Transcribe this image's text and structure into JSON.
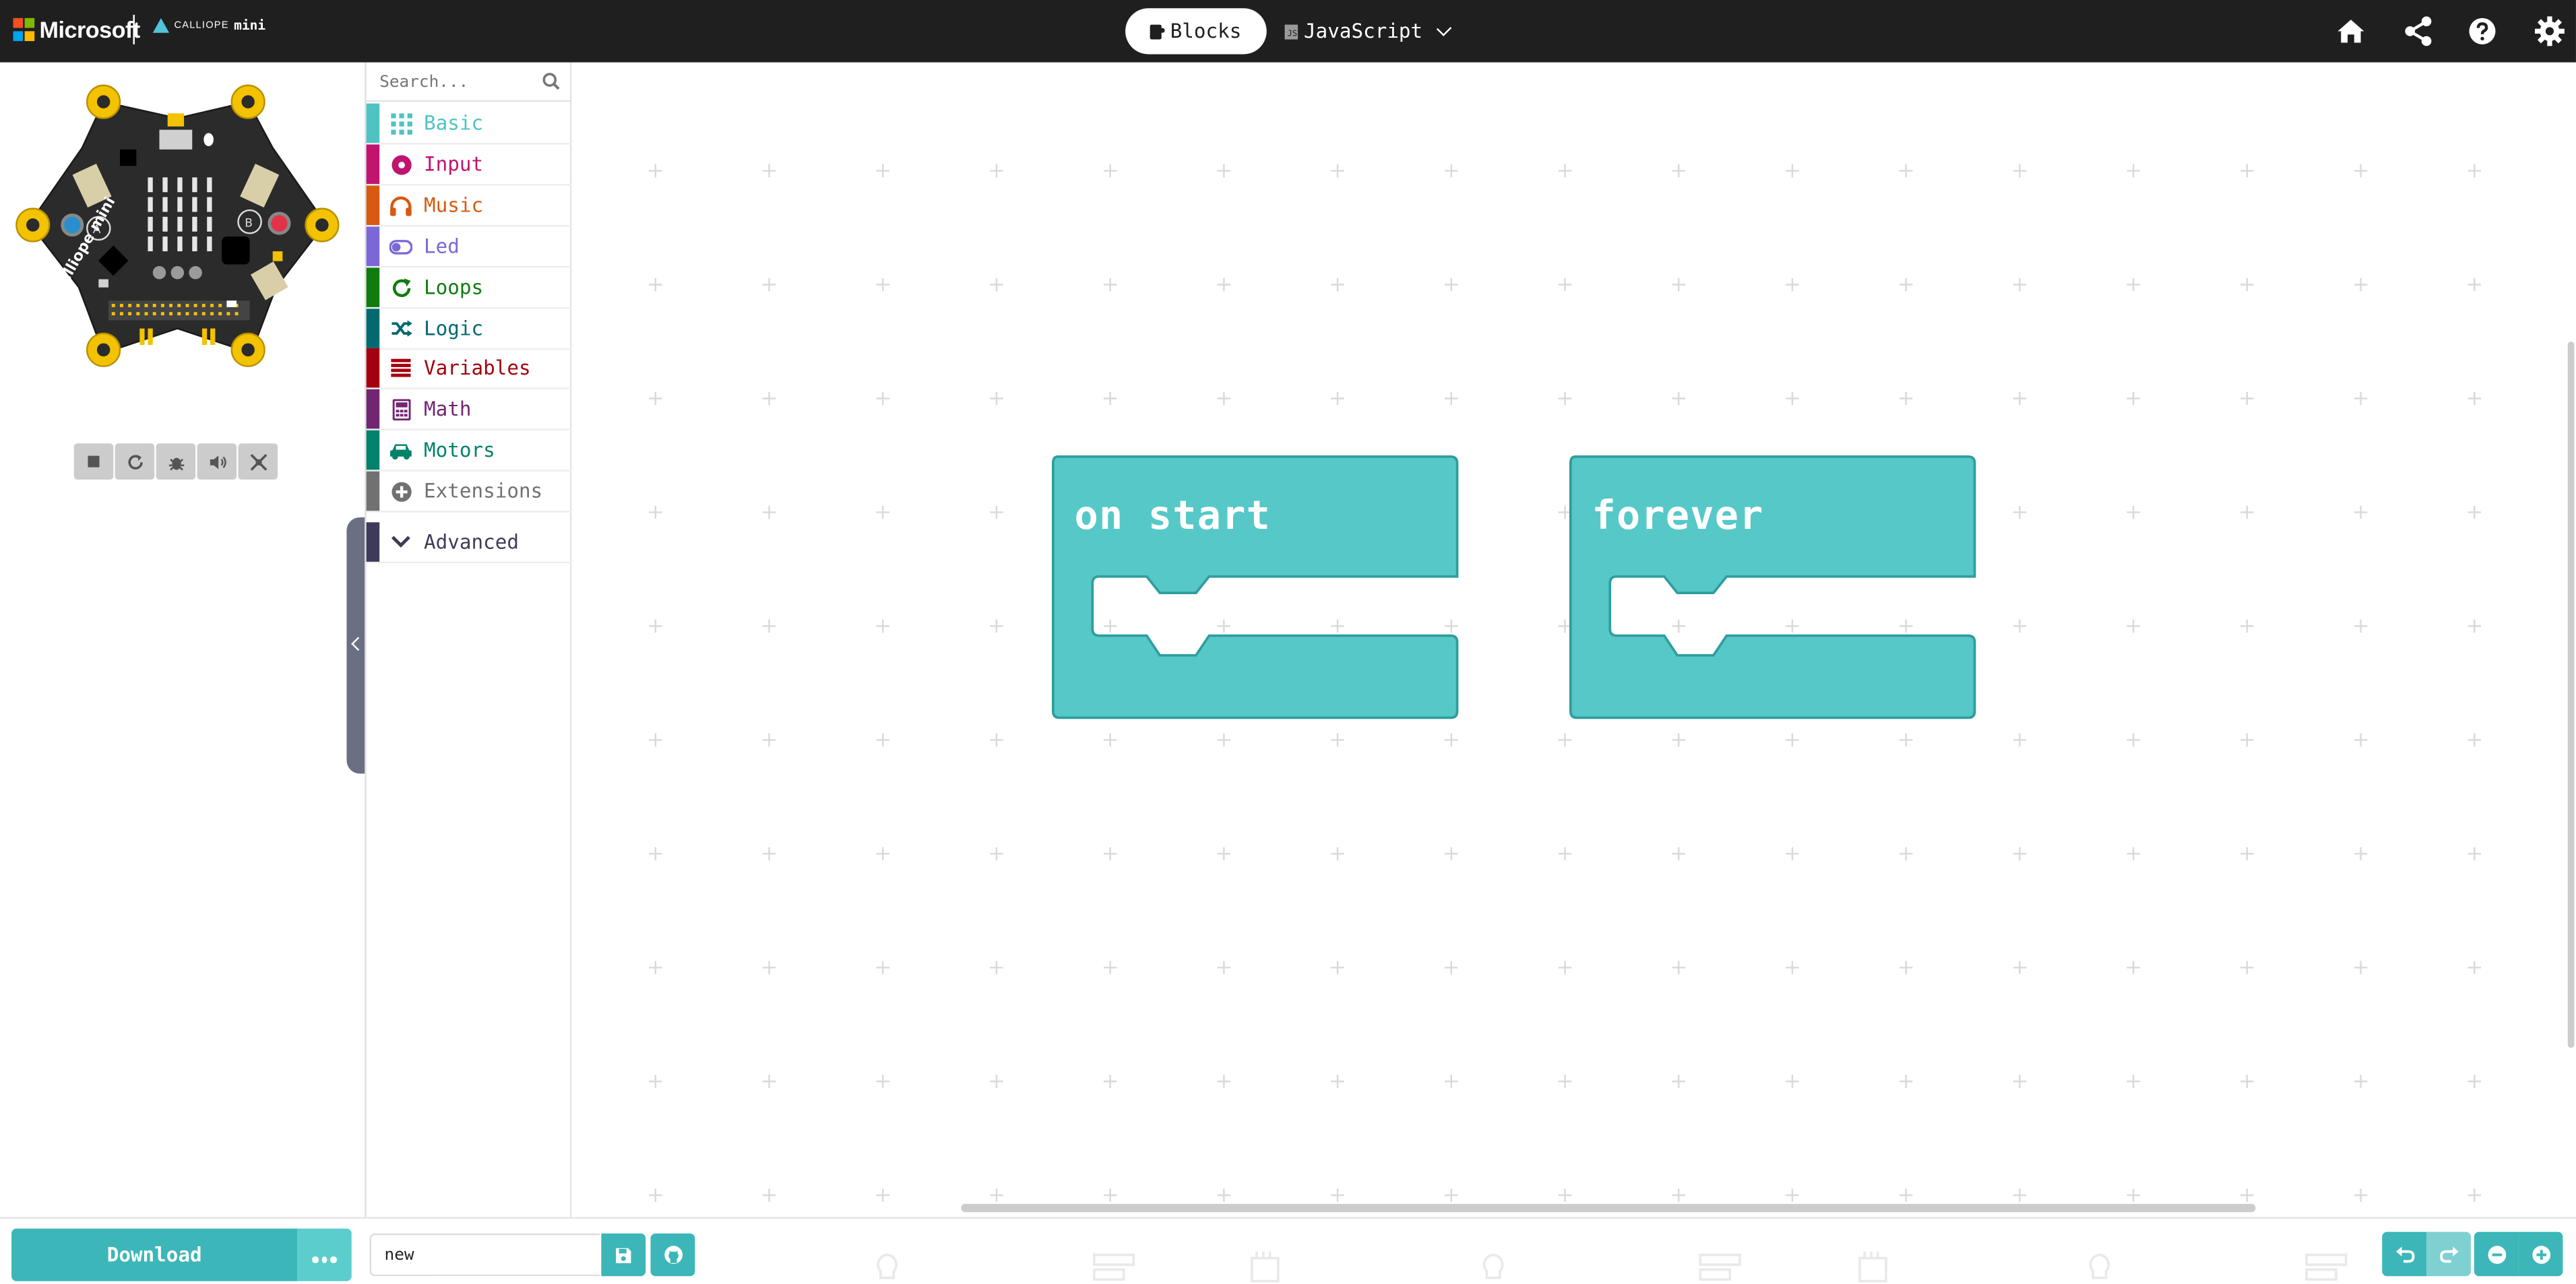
{
  "header": {
    "brand": "Microsoft",
    "product_top": "CALLIOPE",
    "product_bottom": "mini",
    "mode_blocks_label": "Blocks",
    "mode_js_label": "JavaScript",
    "js_badge": "JS",
    "icons": [
      "home-icon",
      "share-icon",
      "help-icon",
      "settings-icon"
    ]
  },
  "simulator": {
    "board_label": "calliope mini",
    "button_a": "A",
    "button_b": "B",
    "controls": [
      "stop-icon",
      "restart-icon",
      "debug-icon",
      "sound-icon",
      "fullscreen-icon"
    ]
  },
  "toolbox": {
    "search_placeholder": "Search...",
    "categories": [
      {
        "label": "Basic",
        "color": "#4fc3c3",
        "icon": "grid-icon"
      },
      {
        "label": "Input",
        "color": "#c0146f",
        "icon": "circle-dot-icon"
      },
      {
        "label": "Music",
        "color": "#d65a12",
        "icon": "headphones-icon"
      },
      {
        "label": "Led",
        "color": "#7b68d6",
        "icon": "toggle-icon"
      },
      {
        "label": "Loops",
        "color": "#107c10",
        "icon": "loop-icon"
      },
      {
        "label": "Logic",
        "color": "#006970",
        "icon": "shuffle-icon"
      },
      {
        "label": "Variables",
        "color": "#a4000f",
        "icon": "list-icon"
      },
      {
        "label": "Math",
        "color": "#712672",
        "icon": "calculator-icon"
      },
      {
        "label": "Motors",
        "color": "#00826b",
        "icon": "car-icon"
      },
      {
        "label": "Extensions",
        "color": "#717171",
        "icon": "plus-circle-icon"
      },
      {
        "label": "Advanced",
        "color": "#3c3c5a",
        "icon": "chevron-down-icon"
      }
    ]
  },
  "workspace": {
    "blocks": [
      {
        "label": "on start"
      },
      {
        "label": "forever"
      }
    ],
    "block_color": "#56c8c8",
    "block_border": "#2f9d9d"
  },
  "footer": {
    "download_label": "Download",
    "project_name": "new",
    "icons": [
      "more-icon",
      "save-icon",
      "github-icon",
      "undo-icon",
      "redo-icon",
      "zoom-out-icon",
      "zoom-in-icon"
    ]
  }
}
